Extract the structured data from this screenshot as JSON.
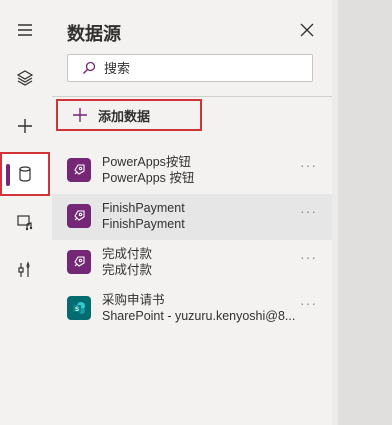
{
  "panel": {
    "title": "数据源",
    "search_placeholder": "搜索",
    "add_label": "添加数据"
  },
  "sources": [
    {
      "line1": "PowerApps按钮",
      "line2": "PowerApps 按钮",
      "icon": "powerapps-icon",
      "color": "#742774",
      "more": "···"
    },
    {
      "line1": "FinishPayment",
      "line2": "FinishPayment",
      "icon": "powerapps-icon",
      "color": "#742774",
      "more": "···"
    },
    {
      "line1": "完成付款",
      "line2": "完成付款",
      "icon": "powerapps-icon",
      "color": "#742774",
      "more": "···"
    },
    {
      "line1": "采购申请书",
      "line2": "SharePoint - yuzuru.kenyoshi@8...",
      "icon": "sharepoint-icon",
      "color": "#036c70",
      "more": "···"
    }
  ],
  "rail": {
    "items": [
      "hamburger-icon",
      "layers-icon",
      "plus-icon",
      "database-icon",
      "media-icon",
      "tools-icon"
    ]
  },
  "colors": {
    "accent": "#742774",
    "highlight": "#d13438"
  }
}
